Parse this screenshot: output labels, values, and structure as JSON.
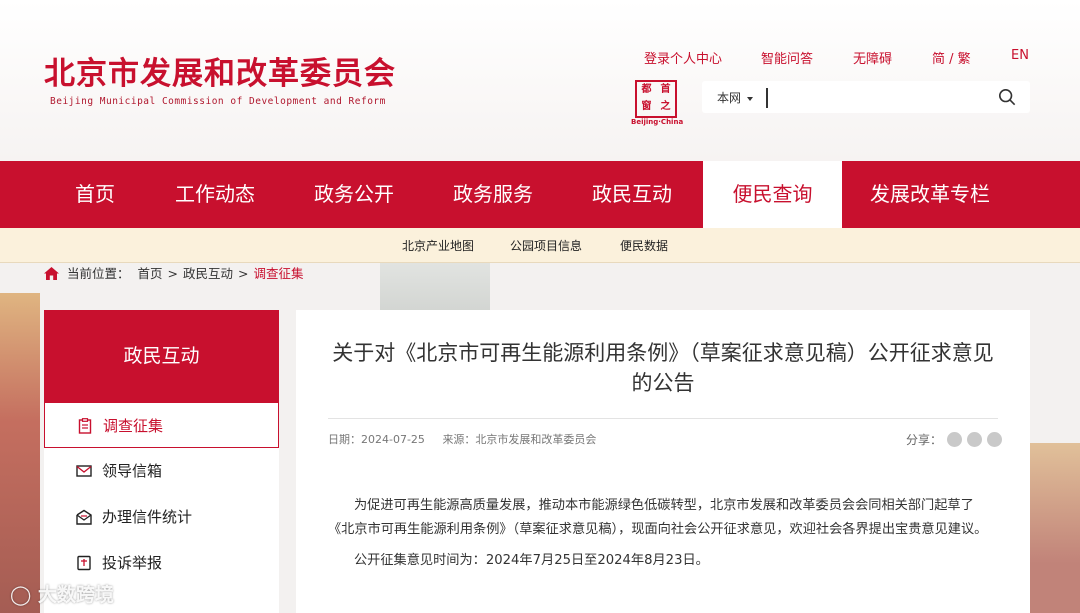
{
  "header": {
    "title": "北京市发展和改革委员会",
    "subtitle": "Beijing Municipal Commission of Development and Reform",
    "links": [
      "登录个人中心",
      "智能问答",
      "无障碍",
      "简 / 繁",
      "EN"
    ],
    "seal": {
      "chars": [
        "首",
        "都",
        "之",
        "窗"
      ],
      "label": "Beijing·China"
    },
    "search": {
      "scope": "本网",
      "value": ""
    }
  },
  "nav": {
    "items": [
      "首页",
      "工作动态",
      "政务公开",
      "政务服务",
      "政民互动",
      "便民查询",
      "发展改革专栏"
    ],
    "active": "便民查询",
    "sub": [
      "北京产业地图",
      "公园项目信息",
      "便民数据"
    ]
  },
  "breadcrumb": {
    "label": "当前位置：",
    "items": [
      "首页",
      "政民互动",
      "调查征集"
    ]
  },
  "sidebar": {
    "title": "政民互动",
    "items": [
      {
        "label": "调查征集",
        "icon": "clipboard-icon"
      },
      {
        "label": "领导信箱",
        "icon": "mail-icon"
      },
      {
        "label": "办理信件统计",
        "icon": "open-mail-icon"
      },
      {
        "label": "投诉举报",
        "icon": "report-icon"
      }
    ]
  },
  "article": {
    "title": "关于对《北京市可再生能源利用条例》（草案征求意见稿）公开征求意见的公告",
    "date": "日期：2024-07-25",
    "source": "来源：北京市发展和改革委员会",
    "share": "分享：",
    "paragraphs": [
      "为促进可再生能源高质量发展，推动本市能源绿色低碳转型，北京市发展和改革委员会会同相关部门起草了《北京市可再生能源利用条例》（草案征求意见稿），现面向社会公开征求意见，欢迎社会各界提出宝贵意见建议。",
      "公开征集意见时间为：2024年7月25日至2024年8月23日。"
    ]
  },
  "watermark": "大数跨境",
  "colors": {
    "brand": "#c8102e",
    "subnav": "#fbf1dc"
  }
}
